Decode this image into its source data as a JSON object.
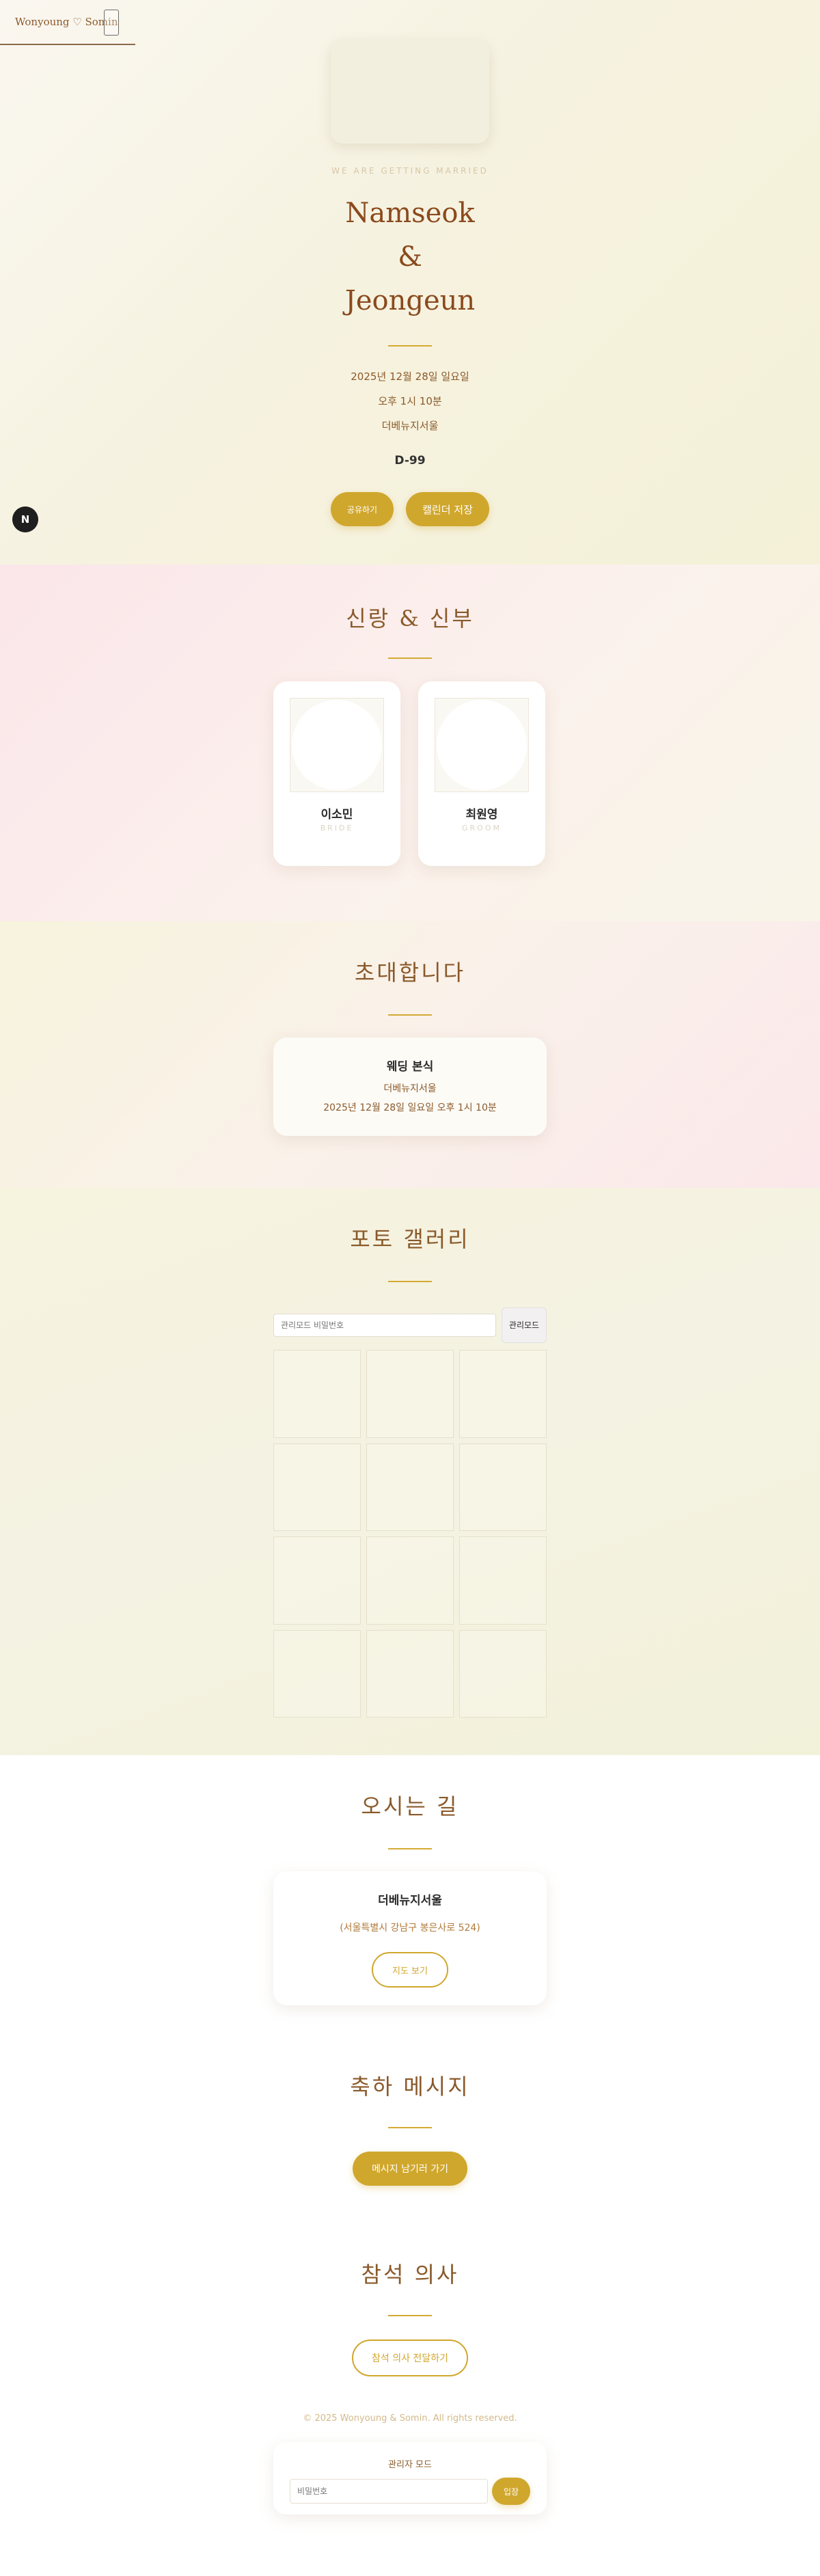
{
  "nav": {
    "brand": "Wonyoung ♡ Somin"
  },
  "hero": {
    "tagline": "WE ARE GETTING MARRIED",
    "name1": "Namseok",
    "amp": "&",
    "name2": "Jeongeun",
    "date": "2025년 12월 28일 일요일",
    "time": "오후 1시 10분",
    "venue": "더베뉴지서울",
    "dday": "D-99",
    "share_label": "공유하기",
    "calendar_label": "캘린더 저장",
    "fab_label": "N"
  },
  "couple": {
    "title": "신랑 & 신부",
    "bride": {
      "name": "이소민",
      "role": "BRIDE"
    },
    "groom": {
      "name": "최원영",
      "role": "GROOM"
    }
  },
  "invite": {
    "title": "초대합니다",
    "card_title": "웨딩 본식",
    "card_venue": "더베뉴지서울",
    "card_datetime": "2025년 12월 28일 일요일 오후 1시 10분"
  },
  "gallery": {
    "title": "포토 갤러리",
    "password_placeholder": "관리모드 비밀번호",
    "admin_label": "관리모드"
  },
  "directions": {
    "title": "오시는 길",
    "venue": "더베뉴지서울",
    "address": "(서울특별시 강남구 봉은사로 524)",
    "map_label": "지도 보기"
  },
  "messages": {
    "title": "축하 메시지",
    "button_label": "메시지 남기러 가기"
  },
  "rsvp": {
    "title": "참석 의사",
    "button_label": "참석 의사 전달하기"
  },
  "footer": {
    "copyright": "© 2025 Wonyoung & Somin. All rights reserved.",
    "admin_title": "관리자 모드",
    "password_placeholder": "비밀번호",
    "login_label": "입장"
  },
  "colors": {
    "accent": "#d0a72d",
    "text": "#8a5a2b",
    "bride_bg": "#fbe6ea"
  }
}
